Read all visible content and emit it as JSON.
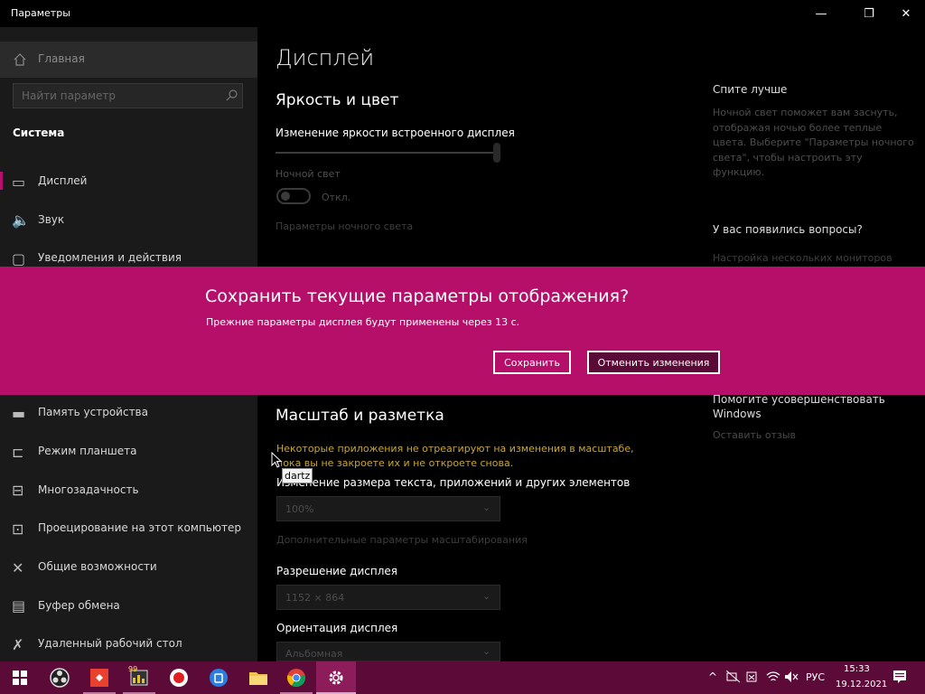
{
  "window": {
    "title": "Параметры",
    "minimize_glyph": "—",
    "maximize_glyph": "❐",
    "close_glyph": "✕"
  },
  "sidebar": {
    "home_label": "Главная",
    "home_icon": "home-icon",
    "search_placeholder": "Найти параметр",
    "search_icon": "search-icon",
    "section_title": "Система",
    "items": [
      {
        "label": "Дисплей",
        "icon": "monitor-icon",
        "glyph": "▭"
      },
      {
        "label": "Звук",
        "icon": "speaker-icon",
        "glyph": "🔈"
      },
      {
        "label": "Уведомления и действия",
        "icon": "notification-icon",
        "glyph": "▢"
      },
      {
        "label": "Память устройства",
        "icon": "storage-icon",
        "glyph": "▬"
      },
      {
        "label": "Режим планшета",
        "icon": "tablet-mode-icon",
        "glyph": "⊏"
      },
      {
        "label": "Многозадачность",
        "icon": "multitasking-icon",
        "glyph": "⊟"
      },
      {
        "label": "Проецирование на этот компьютер",
        "icon": "projecting-icon",
        "glyph": "⊡"
      },
      {
        "label": "Общие возможности",
        "icon": "shared-experiences-icon",
        "glyph": "✕"
      },
      {
        "label": "Буфер обмена",
        "icon": "clipboard-icon",
        "glyph": "▤"
      },
      {
        "label": "Удаленный рабочий стол",
        "icon": "remote-desktop-icon",
        "glyph": "✗"
      }
    ]
  },
  "main": {
    "page_title": "Дисплей",
    "brightness_heading": "Яркость и цвет",
    "brightness_label": "Изменение яркости встроенного дисплея",
    "night_light_label": "Ночной свет",
    "night_light_state": "Откл.",
    "night_light_settings_link": "Параметры ночного света",
    "scale_heading": "Масштаб и разметка",
    "scale_warning": "Некоторые приложения не отреагируют на изменения в масштабе, пока вы не закроете их и не откроете снова.",
    "scale_label": "Изменение размера текста, приложений и других элементов",
    "scale_value": "100%",
    "advanced_scaling_link": "Дополнительные параметры масштабирования",
    "resolution_label": "Разрешение дисплея",
    "resolution_value": "1152 × 864",
    "orientation_label": "Ориентация дисплея",
    "orientation_value": "Альбомная",
    "chevron_glyph": "⌄"
  },
  "right_panel": {
    "sleep_heading": "Спите лучше",
    "sleep_text": "Ночной свет поможет вам заснуть, отображая ночью более теплые цвета. Выберите \"Параметры ночного света\", чтобы настроить эту функцию.",
    "questions_heading": "У вас появились вопросы?",
    "multi_monitor_link": "Настройка нескольких мониторов",
    "improve_heading": "Помогите усовершенствовать Windows",
    "feedback_link": "Оставить отзыв"
  },
  "dialog": {
    "title": "Сохранить текущие параметры отображения?",
    "message": "Прежние параметры дисплея будут применены через 13 с.",
    "save_label": "Сохранить",
    "revert_label": "Отменить изменения",
    "accent_color": "#b50f6a"
  },
  "tooltip": {
    "text": "dartz"
  },
  "taskbar": {
    "color": "#5c0b38",
    "apps": [
      {
        "icon": "windows-start-icon"
      },
      {
        "icon": "obs-icon"
      },
      {
        "icon": "anydesk-icon"
      },
      {
        "icon": "aimp-icon",
        "badge": "99"
      },
      {
        "icon": "record-icon"
      },
      {
        "icon": "bitwarden-icon"
      },
      {
        "icon": "file-explorer-icon"
      },
      {
        "icon": "chrome-icon"
      },
      {
        "icon": "settings-gear-icon"
      }
    ],
    "tray": {
      "chevron": "^",
      "language": "РУС",
      "time": "15:33",
      "date": "19.12.2021",
      "notification_glyph": "▤"
    }
  }
}
